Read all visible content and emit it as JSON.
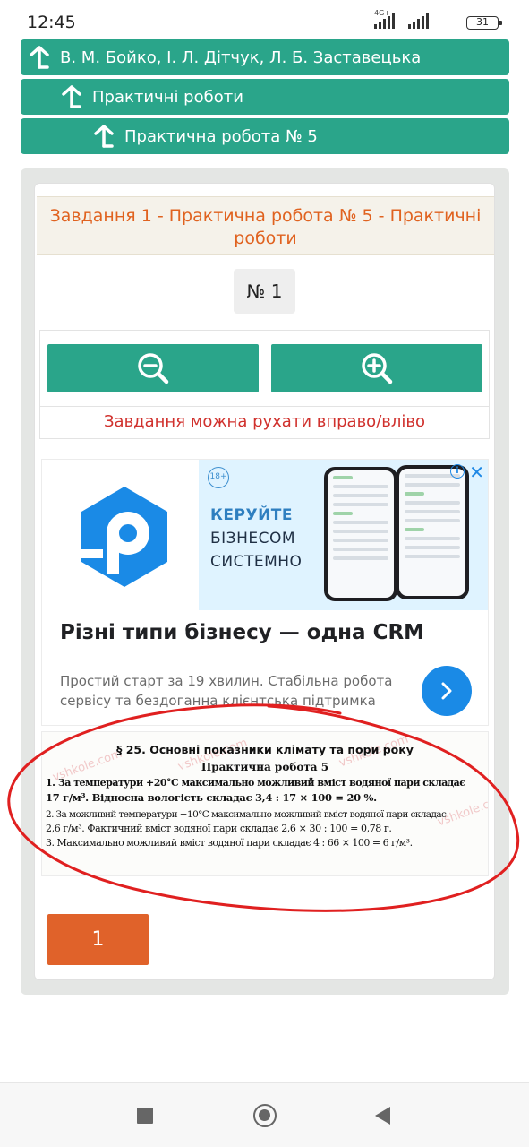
{
  "status_bar": {
    "time": "12:45",
    "network_tag": "4G+",
    "battery": "31"
  },
  "breadcrumbs": [
    {
      "label": "В. М. Бойко, І. Л. Дітчук, Л. Б. Заставецька"
    },
    {
      "label": "Практичні роботи"
    },
    {
      "label": "Практична робота № 5"
    }
  ],
  "task": {
    "title": "Завдання 1 - Практична робота № 5 - Практичні роботи",
    "number": "№ 1",
    "zoom_out_icon": "zoom-out-icon",
    "zoom_in_icon": "zoom-in-icon",
    "hint": "Завдання можна рухати вправо/вліво"
  },
  "ad": {
    "age_badge": "18+",
    "slogan_line1": "КЕРУЙТЕ",
    "slogan_line2": "БІЗНЕСОМ",
    "slogan_line3": "СИСТЕМНО",
    "headline": "Різні типи бізнесу — одна CRM",
    "description": "Простий старт за 19 хвилин. Стабільна робота сервісу та бездоганна клієнтська підтримка",
    "brand_color": "#1a8ae6"
  },
  "textbook": {
    "watermark": "vshkole.com",
    "heading": "§ 25. Основні показники клімату та пори року",
    "subheading": "Практична робота 5",
    "lines": [
      "1. За температури +20°С максимально можливий вміст водяної пари складає",
      "17 г/м³. Відносна вологість складає 3,4 : 17 × 100 = 20 %.",
      "2. За можливий температури −10°С максимально можливий вміст водяної пари складає",
      "2,6 г/м³. Фактичний вміст водяної пари складає 2,6 × 30 : 100 = 0,78 г.",
      "3. Максимально можливий вміст водяної пари складає 4 : 66 × 100 = 6 г/м³."
    ]
  },
  "pagination": {
    "current": "1"
  },
  "colors": {
    "accent_green": "#2aa58a",
    "accent_orange": "#e0622a",
    "hint_red": "#d0312d"
  }
}
